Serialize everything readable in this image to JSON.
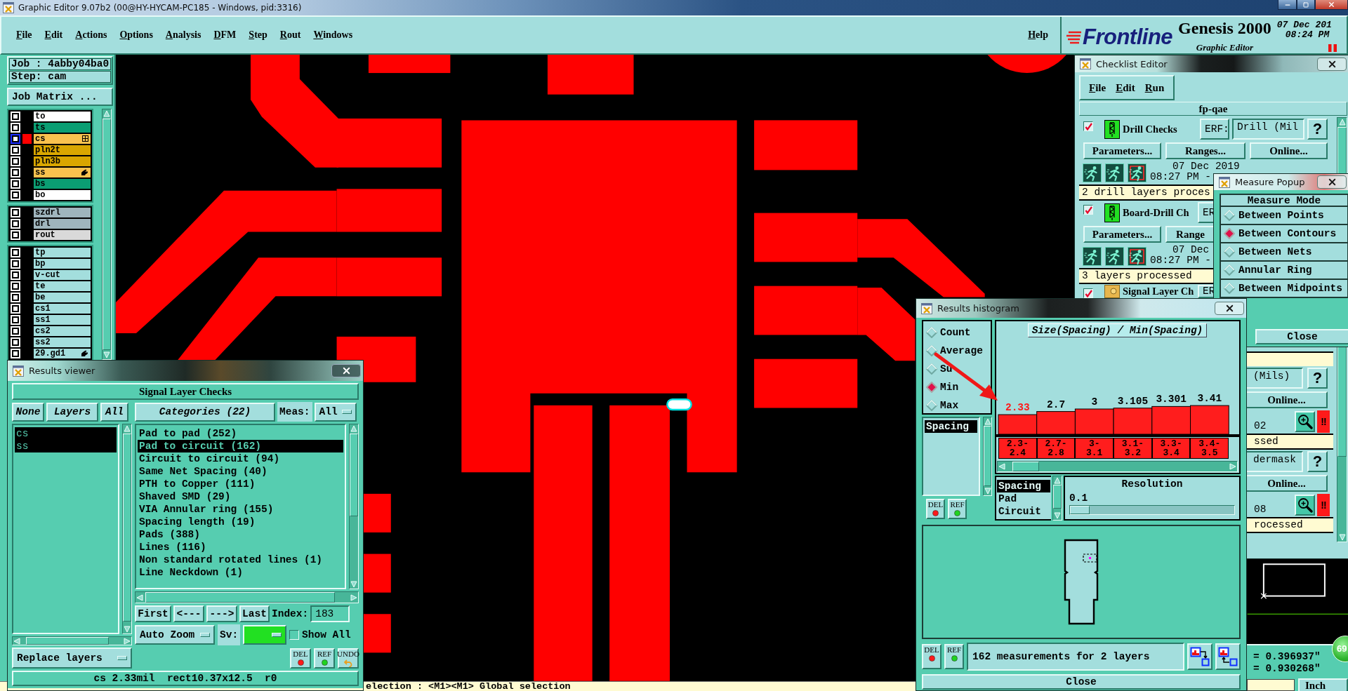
{
  "window": {
    "title": "Graphic Editor 9.07b2 (00@HY-HYCAM-PC185 - Windows, pid:3316)"
  },
  "menu": {
    "items": [
      "File",
      "Edit",
      "Actions",
      "Options",
      "Analysis",
      "DFM",
      "Step",
      "Rout",
      "Windows"
    ],
    "help": "Help"
  },
  "brand": {
    "logo": "Frontline",
    "product": "Genesis 2000",
    "module": "Graphic Editor",
    "date": "07 Dec 201",
    "time": "08:24 PM"
  },
  "job_panel": {
    "job": "Job : 4abby04ba0",
    "step": "Step: cam",
    "matrix_button": "Job Matrix ...",
    "layer_groups": [
      {
        "layers": [
          {
            "name": "to",
            "kind": "plain",
            "color": "#ffffff",
            "checked": false,
            "selected": false,
            "displayed": false
          },
          {
            "name": "ts",
            "kind": "plain",
            "color": "#0b9e73",
            "checked": false,
            "selected": false,
            "displayed": false
          },
          {
            "name": "cs",
            "kind": "grid",
            "color": "#f9c24e",
            "checked": false,
            "selected": true,
            "displayed": true
          },
          {
            "name": "pln2t",
            "kind": "plain",
            "color": "#d9a600",
            "checked": false,
            "selected": false,
            "displayed": false
          },
          {
            "name": "pln3b",
            "kind": "plain",
            "color": "#d9a600",
            "checked": false,
            "selected": false,
            "displayed": false
          },
          {
            "name": "ss",
            "kind": "hand",
            "color": "#f9c24e",
            "checked": false,
            "selected": false,
            "displayed": false
          },
          {
            "name": "bs",
            "kind": "plain",
            "color": "#0b9e73",
            "checked": false,
            "selected": false,
            "displayed": false
          },
          {
            "name": "bo",
            "kind": "plain",
            "color": "#ffffff",
            "checked": false,
            "selected": false,
            "displayed": false
          }
        ]
      },
      {
        "layers": [
          {
            "name": "szdrl",
            "kind": "plain",
            "color": "#9fb5bd",
            "checked": false,
            "selected": false,
            "displayed": false
          },
          {
            "name": "drl",
            "kind": "plain",
            "color": "#9fb5bd",
            "checked": false,
            "selected": false,
            "displayed": false
          },
          {
            "name": "rout",
            "kind": "plain",
            "color": "#d9d9d9",
            "checked": false,
            "selected": false,
            "displayed": false
          }
        ]
      },
      {
        "layers": [
          {
            "name": "tp",
            "kind": "plain",
            "color": "#a3dedd",
            "checked": false,
            "selected": false,
            "displayed": false
          },
          {
            "name": "bp",
            "kind": "plain",
            "color": "#a3dedd",
            "checked": false,
            "selected": false,
            "displayed": false
          },
          {
            "name": "v-cut",
            "kind": "plain",
            "color": "#a3dedd",
            "checked": false,
            "selected": false,
            "displayed": false
          },
          {
            "name": "te",
            "kind": "plain",
            "color": "#a3dedd",
            "checked": false,
            "selected": false,
            "displayed": false
          },
          {
            "name": "be",
            "kind": "plain",
            "color": "#a3dedd",
            "checked": false,
            "selected": false,
            "displayed": false
          },
          {
            "name": "cs1",
            "kind": "plain",
            "color": "#a3dedd",
            "checked": false,
            "selected": false,
            "displayed": false
          },
          {
            "name": "ss1",
            "kind": "plain",
            "color": "#a3dedd",
            "checked": false,
            "selected": false,
            "displayed": false
          },
          {
            "name": "cs2",
            "kind": "plain",
            "color": "#a3dedd",
            "checked": false,
            "selected": false,
            "displayed": false
          },
          {
            "name": "ss2",
            "kind": "plain",
            "color": "#a3dedd",
            "checked": false,
            "selected": false,
            "displayed": false
          },
          {
            "name": "29.gd1",
            "kind": "hand",
            "color": "#a3dedd",
            "checked": false,
            "selected": false,
            "displayed": false
          }
        ]
      }
    ]
  },
  "status_line": "election : <M1><M1> Global selection",
  "results_viewer": {
    "title": "Results viewer",
    "heading": "Signal Layer Checks",
    "layer_buttons": [
      "None",
      "Layers",
      "All"
    ],
    "layers": [
      {
        "name": "cs",
        "selected": true
      },
      {
        "name": "ss",
        "selected": true
      }
    ],
    "replace_option": "Replace layers",
    "categories_button": "Categories (22)",
    "meas_label": "Meas:",
    "meas_value": "All",
    "categories": [
      {
        "label": "Pad to pad (252)",
        "selected": false
      },
      {
        "label": "Pad to circuit (162)",
        "selected": true
      },
      {
        "label": "Circuit to circuit (94)",
        "selected": false
      },
      {
        "label": "Same Net Spacing (40)",
        "selected": false
      },
      {
        "label": "PTH to Copper (111)",
        "selected": false
      },
      {
        "label": "Shaved SMD (29)",
        "selected": false
      },
      {
        "label": "VIA Annular ring (155)",
        "selected": false
      },
      {
        "label": "Spacing length (19)",
        "selected": false
      },
      {
        "label": "Pads (388)",
        "selected": false
      },
      {
        "label": "Lines (116)",
        "selected": false
      },
      {
        "label": "Non standard rotated lines (1)",
        "selected": false
      },
      {
        "label": "Line Neckdown (1)",
        "selected": false
      }
    ],
    "nav_buttons": [
      "First",
      "<---",
      "--->",
      "Last"
    ],
    "index_label": "Index:",
    "index_value": "183",
    "zoom_option": "Auto Zoom",
    "sv_label": "Sv:",
    "show_all": {
      "label": "Show All",
      "checked": false
    },
    "tools": [
      {
        "label": "DEL",
        "kind": "delete"
      },
      {
        "label": "REF",
        "kind": "refresh"
      },
      {
        "label": "UNDO",
        "kind": "undo"
      }
    ],
    "status": "cs 2.33mil  rect10.37x12.5  r0"
  },
  "checklist": {
    "title": "Checklist Editor",
    "menu": [
      "File",
      "Edit",
      "Run"
    ],
    "name": "fp-qae",
    "checks": [
      {
        "title": "Drill Checks",
        "kind": "drill",
        "checked": true,
        "erf_button": "ERF:",
        "erf_value": "Drill (Mil",
        "help": "?",
        "buttons": [
          "Parameters...",
          "Ranges...",
          "Online..."
        ],
        "date": "07 Dec 2019",
        "time": "08:27 PM -",
        "status": "2 drill layers proces"
      },
      {
        "title": "Board-Drill Ch",
        "kind": "drill",
        "checked": true,
        "erf_button": "ER",
        "buttons": [
          "Parameters...",
          "Range"
        ],
        "date": "07 Dec",
        "time": "08:27 PM -",
        "status": "3 layers processed"
      },
      {
        "title": "Signal Layer Ch",
        "kind": "signal",
        "checked": true,
        "erf_button": "ER"
      },
      {
        "erf_value": "(Mils)",
        "help": "?",
        "buttons": [
          "Online..."
        ],
        "time": "02",
        "alert": "!!",
        "status": "ssed"
      },
      {
        "erf_value": "dermask",
        "help": "?",
        "buttons": [
          "Online..."
        ],
        "time": "08",
        "alert": "!!",
        "status": "rocessed"
      }
    ]
  },
  "measure_popup": {
    "title": "Measure Popup",
    "heading": "Measure Mode",
    "modes": [
      {
        "label": "Between Points",
        "selected": false
      },
      {
        "label": "Between Contours",
        "selected": true
      },
      {
        "label": "Between Nets",
        "selected": false
      },
      {
        "label": "Annular Ring",
        "selected": false
      },
      {
        "label": "Between Midpoints",
        "selected": false
      }
    ],
    "close": "Close"
  },
  "histogram": {
    "title": "Results histogram",
    "functions": [
      {
        "label": "Count",
        "selected": false
      },
      {
        "label": "Average",
        "selected": false
      },
      {
        "label": "Su",
        "selected": false
      },
      {
        "label": "Min",
        "selected": true
      },
      {
        "label": "Max",
        "selected": false
      }
    ],
    "attributes": [
      {
        "label": "Spacing",
        "selected": true
      }
    ],
    "attribute_tools": [
      {
        "label": "DEL",
        "kind": "delete"
      },
      {
        "label": "REF",
        "kind": "refresh"
      }
    ],
    "chart_data": {
      "type": "bar",
      "title": "Size(Spacing) / Min(Spacing)",
      "categories": [
        "2.3-2.4",
        "2.7-2.8",
        "3-3.1",
        "3.1-3.2",
        "3.3-3.4",
        "3.4-3.5"
      ],
      "values": [
        2.33,
        2.7,
        3,
        3.105,
        3.301,
        3.41
      ],
      "data_labels": true
    },
    "bins": [
      {
        "selected": true
      },
      {
        "selected": false
      },
      {
        "selected": false
      },
      {
        "selected": false
      },
      {
        "selected": false
      },
      {
        "selected": false
      }
    ],
    "types": [
      {
        "label": "Spacing",
        "selected": true
      },
      {
        "label": "Pad",
        "selected": false
      },
      {
        "label": "Circuit",
        "selected": false
      }
    ],
    "resolution": {
      "label": "Resolution",
      "value": "0.1",
      "level": 0
    },
    "tools": [
      {
        "label": "DEL",
        "kind": "delete"
      },
      {
        "label": "REF",
        "kind": "refresh"
      }
    ],
    "summary": "162 measurements for 2 layers",
    "close": "Close"
  },
  "coordinates": {
    "values": [
      "= 0.396937\"",
      "= 0.930268\""
    ],
    "units": "Inch",
    "badge": "69"
  }
}
